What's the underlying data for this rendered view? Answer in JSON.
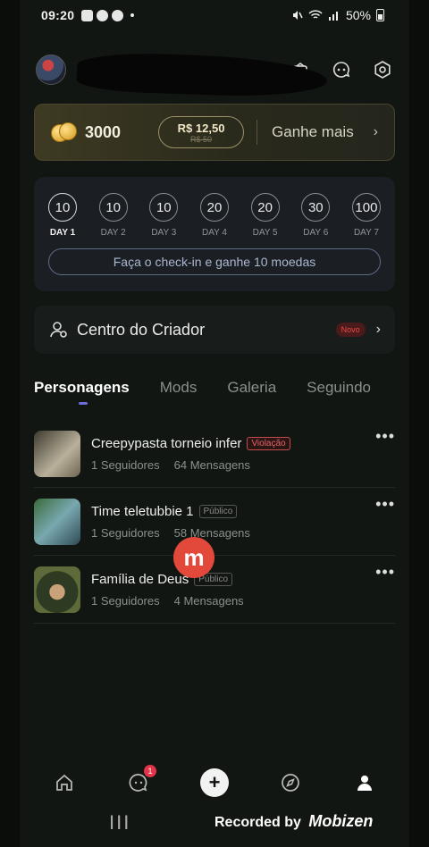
{
  "status": {
    "time": "09:20",
    "battery": "50%"
  },
  "header": {},
  "coins": {
    "amount": "3000",
    "price_new": "R$ 12,50",
    "price_old": "R$ 50",
    "earn_label": "Ganhe mais"
  },
  "checkin": {
    "days": [
      {
        "value": "10",
        "label": "DAY 1"
      },
      {
        "value": "10",
        "label": "DAY 2"
      },
      {
        "value": "10",
        "label": "DAY 3"
      },
      {
        "value": "20",
        "label": "DAY 4"
      },
      {
        "value": "20",
        "label": "DAY 5"
      },
      {
        "value": "30",
        "label": "DAY 6"
      },
      {
        "value": "100",
        "label": "DAY 7"
      }
    ],
    "button_label": "Faça o check-in e ganhe 10 moedas"
  },
  "creator": {
    "label": "Centro do Criador",
    "badge": "Novo"
  },
  "tabs": [
    "Personagens",
    "Mods",
    "Galeria",
    "Seguindo"
  ],
  "characters": [
    {
      "title": "Creepypasta torneio infer",
      "tag": "Violação",
      "followers": "1 Seguidores",
      "messages": "64 Mensagens"
    },
    {
      "title": "Time teletubbie 1",
      "tag": "Público",
      "followers": "1 Seguidores",
      "messages": "58 Mensagens"
    },
    {
      "title": "Família de Deus",
      "tag": "Público",
      "followers": "1 Seguidores",
      "messages": "4 Mensagens"
    }
  ],
  "bottom_nav": {
    "chat_badge": "1"
  },
  "overlay": {
    "recorded_label": "Recorded by",
    "brand": "Mobizen"
  }
}
